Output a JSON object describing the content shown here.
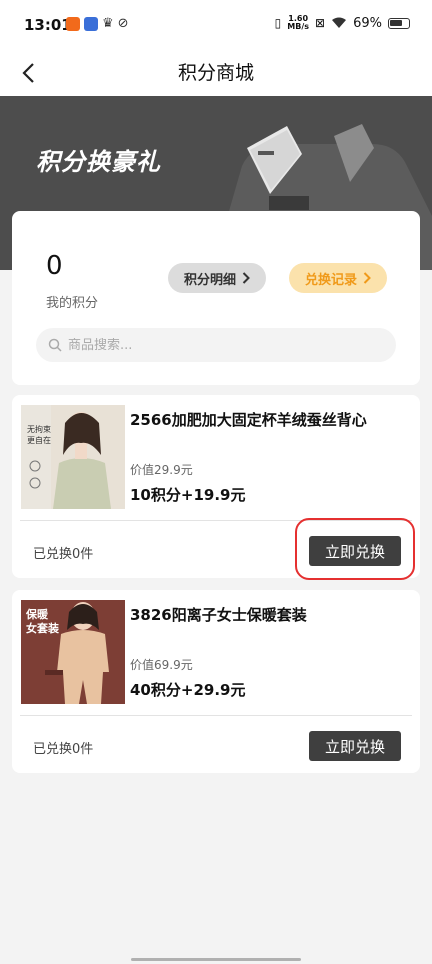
{
  "status_bar": {
    "time": "13:01",
    "net_speed_value": "1.60",
    "net_speed_unit": "MB/s",
    "battery": "69%"
  },
  "nav": {
    "title": "积分商城"
  },
  "banner": {
    "text": "积分换豪礼"
  },
  "points": {
    "value": "0",
    "label": "我的积分",
    "detail_btn": "积分明细",
    "records_btn": "兑换记录"
  },
  "search": {
    "placeholder": "商品搜索..."
  },
  "products": [
    {
      "name": "2566加肥加大固定杯羊绒蚕丝背心",
      "value": "价值29.9元",
      "price": "10积分+19.9元",
      "redeemed": "已兑换0件",
      "button": "立即兑换",
      "thumb_text": [
        "无拘束",
        "更自在"
      ]
    },
    {
      "name": "3826阳离子女士保暖套装",
      "value": "价值69.9元",
      "price": "40积分+29.9元",
      "redeemed": "已兑换0件",
      "button": "立即兑换",
      "thumb_text": [
        "保暖",
        "女套装"
      ]
    }
  ],
  "colors": {
    "banner_bg": "#4d4d4d",
    "records_accent": "#f09a1a",
    "button_bg": "#3f3f3f",
    "highlight": "#e53030"
  }
}
